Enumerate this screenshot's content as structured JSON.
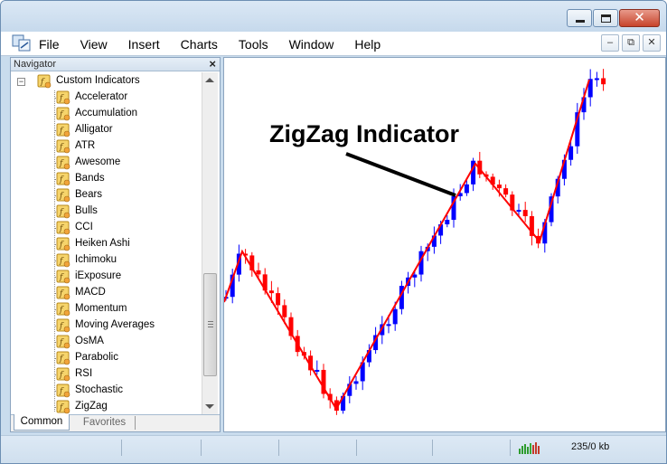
{
  "window": {
    "close_glyph": "✕"
  },
  "menu": {
    "items": [
      "File",
      "View",
      "Insert",
      "Charts",
      "Tools",
      "Window",
      "Help"
    ],
    "mdi_minimize": "–",
    "mdi_restore": "⧉",
    "mdi_close": "✕"
  },
  "navigator": {
    "title": "Navigator",
    "close_glyph": "×",
    "root": {
      "label": "Custom Indicators",
      "expander": "−"
    },
    "items": [
      "Accelerator",
      "Accumulation",
      "Alligator",
      "ATR",
      "Awesome",
      "Bands",
      "Bears",
      "Bulls",
      "CCI",
      "Heiken Ashi",
      "Ichimoku",
      "iExposure",
      "MACD",
      "Momentum",
      "Moving Averages",
      "OsMA",
      "Parabolic",
      "RSI",
      "Stochastic",
      "ZigZag"
    ],
    "tabs": [
      "Common",
      "Favorites"
    ],
    "icons": {
      "indicator": "custom-indicator-icon",
      "folder": "custom-indicators-folder-icon"
    }
  },
  "chart": {
    "annotation": "ZigZag Indicator",
    "colors": {
      "bull_candle": "#0000ff",
      "bear_candle": "#ff0000",
      "zigzag_line": "#ff0000",
      "arrow": "#000000"
    }
  },
  "status": {
    "traffic_icon": "connection-traffic-icon",
    "size": "235/0 kb"
  }
}
